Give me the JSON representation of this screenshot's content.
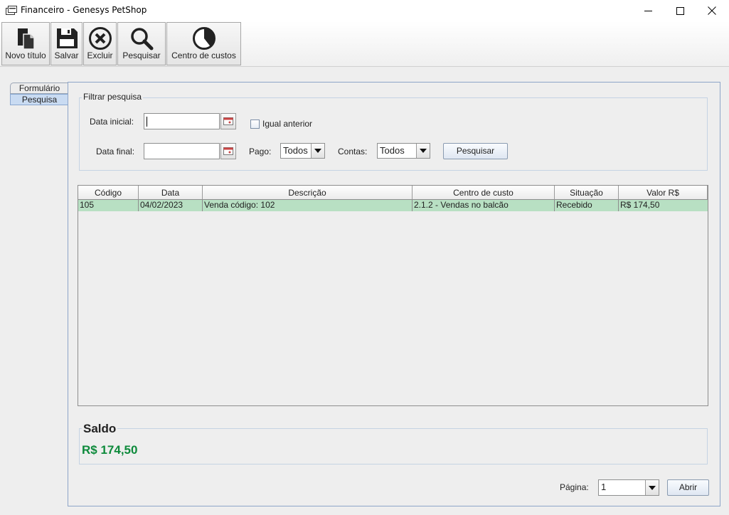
{
  "window": {
    "title": "Financeiro - Genesys PetShop",
    "controls": {
      "minimize_icon": "minimize-icon",
      "maximize_icon": "maximize-icon",
      "close_icon": "close-icon"
    }
  },
  "toolbar": {
    "novo": "Novo título",
    "salvar": "Salvar",
    "excluir": "Excluir",
    "pesquisar": "Pesquisar",
    "centro": "Centro de custos"
  },
  "tabs": [
    "Formulário",
    "Pesquisa"
  ],
  "active_tab": "Pesquisa",
  "filter": {
    "legend": "Filtrar pesquisa",
    "data_inicial_label": "Data inicial:",
    "data_inicial_value": "",
    "data_final_label": "Data final:",
    "data_final_value": "",
    "igual_anterior_label": "Igual anterior",
    "igual_anterior_checked": false,
    "pago_label": "Pago:",
    "pago_value": "Todos",
    "contas_label": "Contas:",
    "contas_value": "Todos",
    "pesquisar_button": "Pesquisar"
  },
  "table": {
    "columns": [
      "Código",
      "Data",
      "Descrição",
      "Centro de custo",
      "Situação",
      "Valor R$"
    ],
    "rows": [
      [
        "105",
        "04/02/2023",
        "Venda código: 102",
        "2.1.2 - Vendas no balcão",
        "Recebido",
        "R$ 174,50"
      ]
    ],
    "selected_row_color": "#b8e0c3"
  },
  "saldo": {
    "legend": "Saldo",
    "value": "R$ 174,50",
    "value_color": "#0d8a3b"
  },
  "footer": {
    "pagina_label": "Página:",
    "pagina_value": "1",
    "abrir_button": "Abrir"
  }
}
